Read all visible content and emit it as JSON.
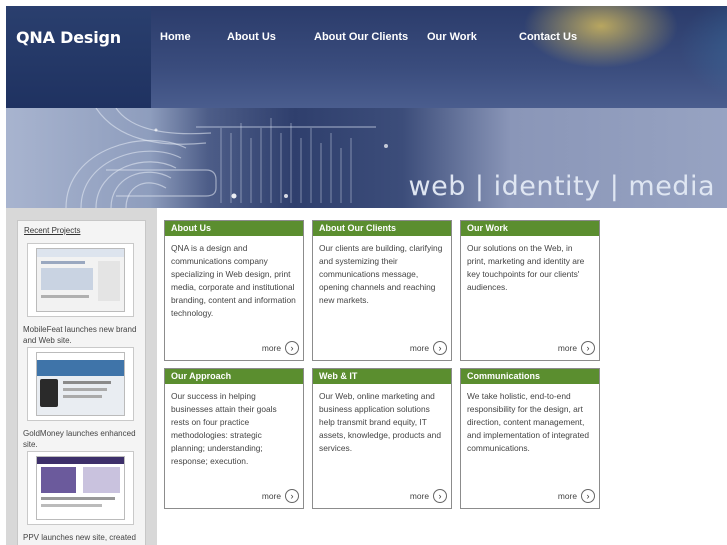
{
  "site": {
    "logo": "QNA Design"
  },
  "nav": {
    "items": [
      {
        "label": "Home"
      },
      {
        "label": "About Us"
      },
      {
        "label": "About Our Clients"
      },
      {
        "label": "Our Work"
      },
      {
        "label": "Contact Us"
      }
    ]
  },
  "banner": {
    "tagline": "web | identity | media"
  },
  "sidebar": {
    "title": "Recent Projects",
    "items": [
      {
        "caption": "MobileFeat launches new brand and Web site."
      },
      {
        "caption": "GoldMoney launches enhanced site."
      },
      {
        "caption": "PPV launches new site, created with partner Ops"
      }
    ]
  },
  "cards": [
    {
      "title": "About Us",
      "body": "QNA is a design and communications company specializing in Web design, print media, corporate and institutional branding, content and information technology.",
      "more": "more"
    },
    {
      "title": "About Our Clients",
      "body": "Our clients are building, clarifying and systemizing their communications message, opening channels and reaching new markets.",
      "more": "more"
    },
    {
      "title": "Our Work",
      "body": "Our solutions on the Web, in print, marketing and identity are key touchpoints for our clients' audiences.",
      "more": "more"
    },
    {
      "title": "Our Approach",
      "body": "Our success in helping businesses attain their goals rests on four practice methodologies: strategic planning; understanding; response; execution.",
      "more": "more"
    },
    {
      "title": "Web & IT",
      "body": "Our Web, online marketing and business application solutions help transmit brand equity, IT assets, knowledge, products and services.",
      "more": "more"
    },
    {
      "title": "Communications",
      "body": "We take holistic, end-to-end responsibility for the design, art direction, content management, and implementation of integrated communications.",
      "more": "more"
    }
  ],
  "icons": {
    "more": "arrow-right-circle-icon"
  },
  "colors": {
    "header_bg": "#2a3f6e",
    "card_head": "#5b8e2f",
    "sidebar_bg": "#d8d8d8"
  }
}
